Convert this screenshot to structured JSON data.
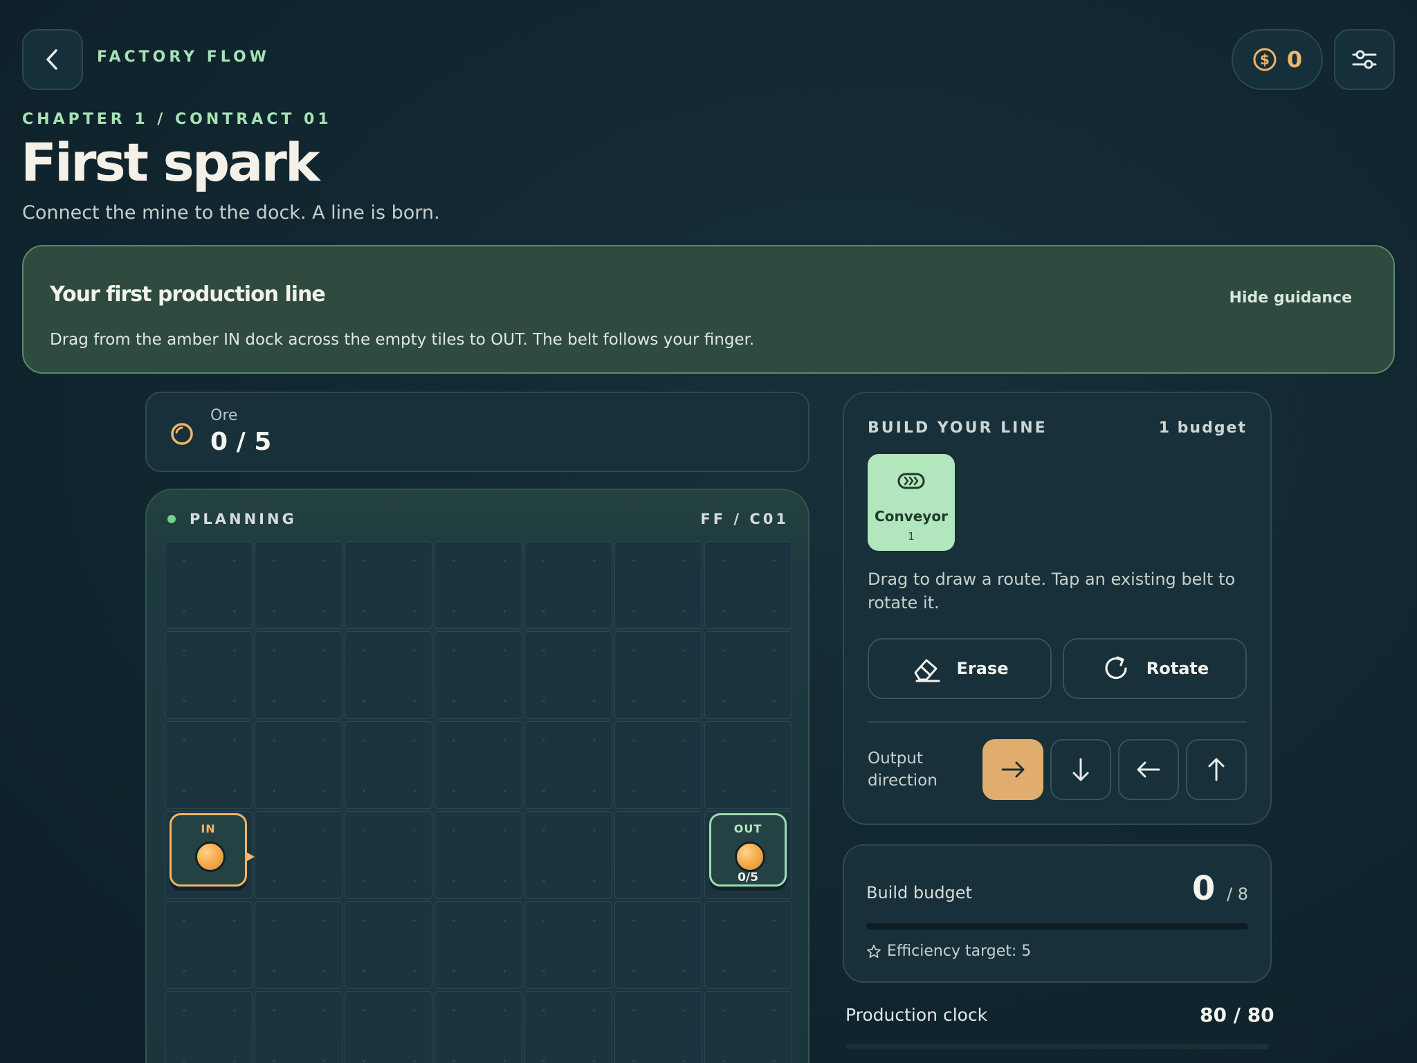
{
  "header": {
    "brand": "FACTORY FLOW",
    "coins": "0",
    "back_icon": "chevron-left-icon",
    "settings_icon": "sliders-icon",
    "coin_icon": "dollar-coin-icon"
  },
  "level": {
    "chapter": "CHAPTER 1 / CONTRACT 01",
    "title": "First spark",
    "subtitle": "Connect the mine to the dock. A line is born."
  },
  "guidance": {
    "title": "Your first production line",
    "hide_label": "Hide guidance",
    "text": "Drag from the amber IN dock across the empty tiles to OUT. The belt follows your finger."
  },
  "resource": {
    "label": "Ore",
    "value": "0 / 5",
    "delivered": 0,
    "target": 5
  },
  "board": {
    "status": "PLANNING",
    "code": "FF / C01",
    "cols": 7,
    "rows": 6,
    "in_label": "IN",
    "out_label": "OUT",
    "out_count": "0/5"
  },
  "build_panel": {
    "heading": "BUILD YOUR LINE",
    "budget_label": "1 budget",
    "tool": {
      "name": "Conveyor",
      "count": "1",
      "icon": "conveyor-icon"
    },
    "hint": "Drag to draw a route. Tap an existing belt to rotate it.",
    "erase_label": "Erase",
    "rotate_label": "Rotate",
    "direction_label": "Output direction",
    "directions": [
      "right",
      "down",
      "left",
      "up"
    ],
    "selected_direction": "right"
  },
  "budget": {
    "label": "Build budget",
    "used": "0",
    "max": "/ 8",
    "used_fraction": 0,
    "efficiency": "Efficiency target: 5"
  },
  "clock": {
    "label": "Production clock",
    "value": "80 / 80",
    "fraction": 1
  },
  "colors": {
    "accent_amber": "#e0ad6f",
    "accent_green": "#a7e2b4",
    "background": "#11262f"
  }
}
